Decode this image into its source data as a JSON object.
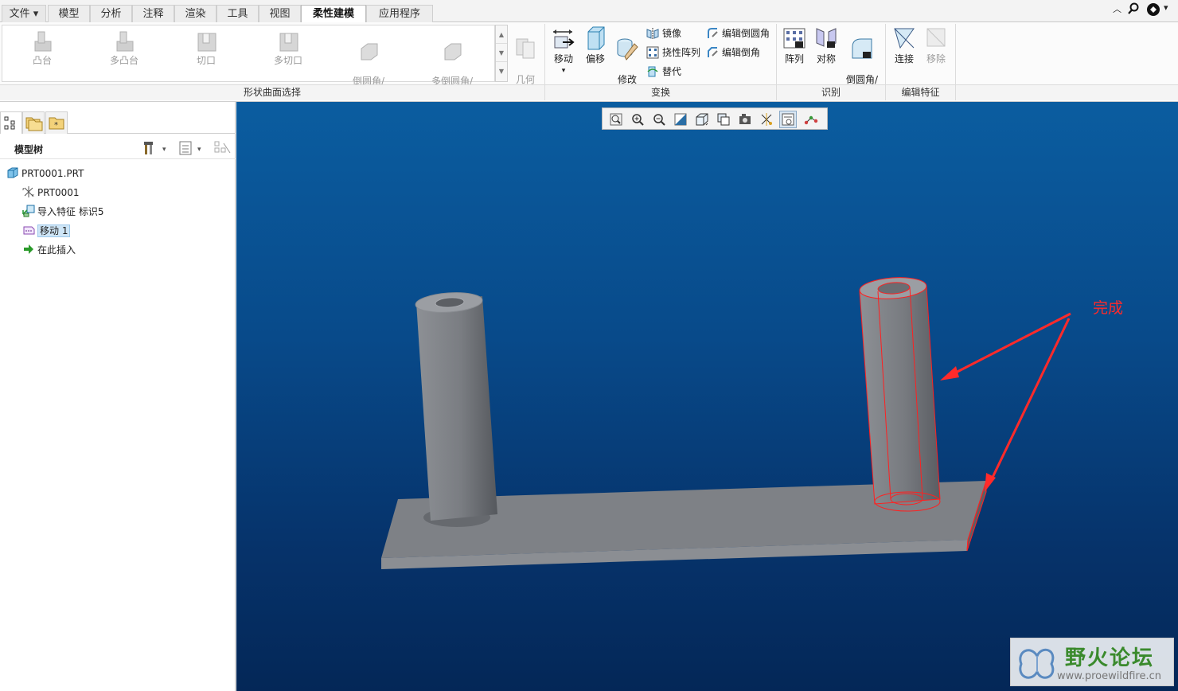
{
  "tabs": {
    "file": "文件",
    "model": "模型",
    "analysis": "分析",
    "annotate": "注释",
    "render": "渲染",
    "tools": "工具",
    "view": "视图",
    "flex": "柔性建模",
    "apps": "应用程序"
  },
  "gallery": {
    "boss": "凸台",
    "multi_boss": "多凸台",
    "cut": "切口",
    "multi_cut": "多切口",
    "round_chamfer": "倒圆角/\n倒角",
    "multi_round_chamfer": "多倒圆角/\n倒角",
    "geom_rules": "几何\n规则"
  },
  "transform": {
    "move": "移动",
    "offset": "偏移",
    "modify_analytic": "修改\n解析",
    "mirror": "镜像",
    "flex_pattern": "挠性阵列",
    "substitute": "替代",
    "edit_round": "编辑倒圆角",
    "edit_chamfer": "编辑倒角"
  },
  "recognize": {
    "pattern": "阵列",
    "symmetry": "对称",
    "round_chamfer": "倒圆角/\n倒角"
  },
  "edit_feature": {
    "attach": "连接",
    "remove": "移除"
  },
  "groups": {
    "shape_surface": "形状曲面选择",
    "transform": "变换",
    "recognize": "识别",
    "edit_feature": "编辑特征"
  },
  "panel": {
    "title": "模型树"
  },
  "tree": [
    {
      "label": "PRT0001.PRT"
    },
    {
      "label": "PRT0001"
    },
    {
      "label": "导入特征 标识5"
    },
    {
      "label": "移动 1"
    },
    {
      "label": "在此插入"
    }
  ],
  "annotation": "完成",
  "watermark": {
    "title": "野火论坛",
    "url": "www.proewildfire.cn"
  },
  "colors": {
    "annotation": "#ff2a2a",
    "viewport_top": "#0b5da0",
    "viewport_bottom": "#042757",
    "part": "#7a7d82",
    "selection": "#ff2020"
  }
}
